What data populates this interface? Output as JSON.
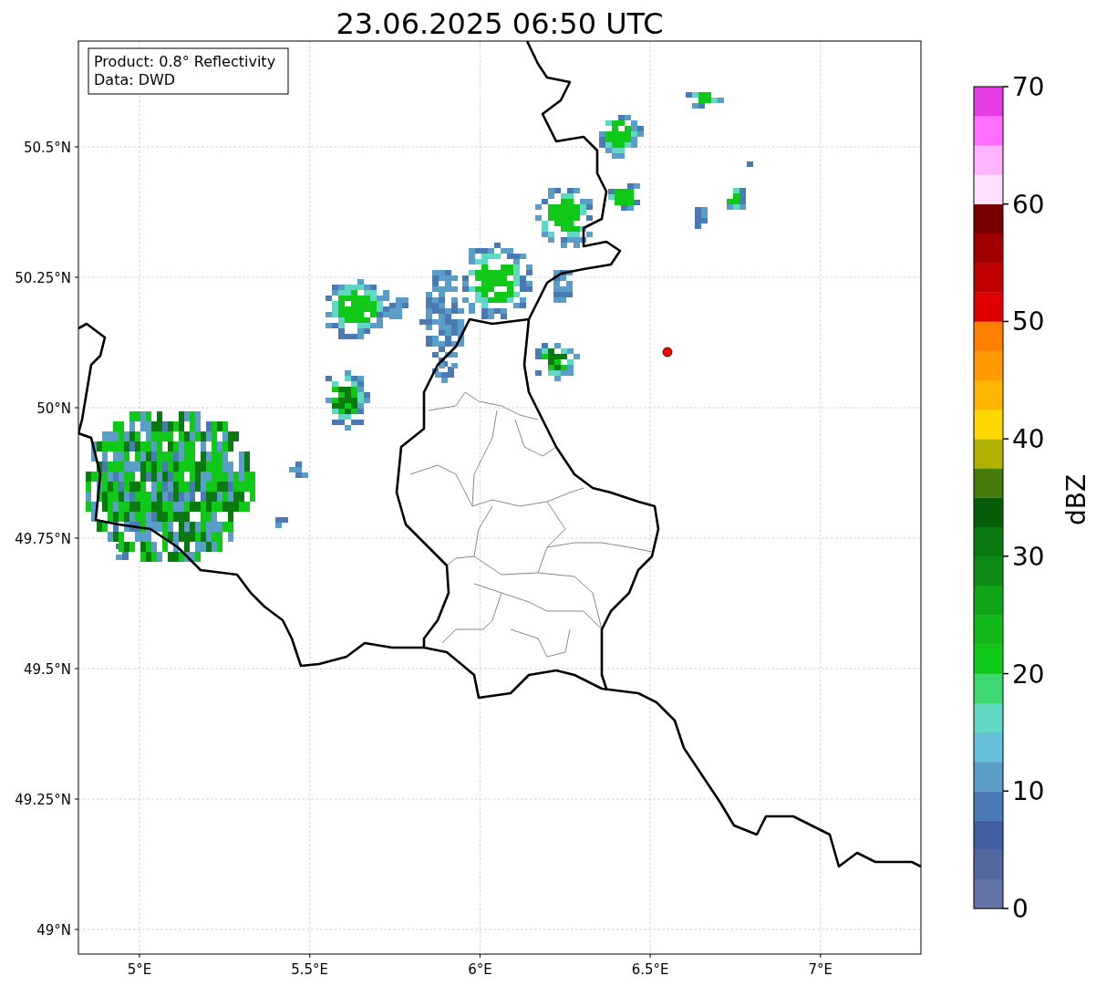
{
  "title": "23.06.2025 06:50 UTC",
  "info_box": [
    "Product: 0.8° Reflectivity",
    "Data: DWD"
  ],
  "axes": {
    "xticks": [
      "5°E",
      "5.5°E",
      "6°E",
      "6.5°E",
      "7°E"
    ],
    "yticks": [
      "50.5°N",
      "50.25°N",
      "50°N",
      "49.75°N",
      "49.5°N",
      "49.25°N",
      "49°N"
    ]
  },
  "colorbar": {
    "label": "dBZ",
    "ticks": [
      "70",
      "60",
      "50",
      "40",
      "30",
      "20",
      "10",
      "0"
    ],
    "bins": [
      {
        "color": "#6474a6"
      },
      {
        "color": "#52689e"
      },
      {
        "color": "#4260a0"
      },
      {
        "color": "#4a7ab4"
      },
      {
        "color": "#5a9ec8"
      },
      {
        "color": "#66c0dc"
      },
      {
        "color": "#60d8c4"
      },
      {
        "color": "#3ed870"
      },
      {
        "color": "#10c818"
      },
      {
        "color": "#10b818"
      },
      {
        "color": "#10a418"
      },
      {
        "color": "#0c8c14"
      },
      {
        "color": "#0a7a10"
      },
      {
        "color": "#065e0a"
      },
      {
        "color": "#467a0a"
      },
      {
        "color": "#b0b000"
      },
      {
        "color": "#ffd700"
      },
      {
        "color": "#ffb400"
      },
      {
        "color": "#ff9b00"
      },
      {
        "color": "#ff7f00"
      },
      {
        "color": "#e00000"
      },
      {
        "color": "#c00000"
      },
      {
        "color": "#a00000"
      },
      {
        "color": "#780000"
      },
      {
        "color": "#ffe0ff"
      },
      {
        "color": "#ffb4ff"
      },
      {
        "color": "#ff6eff"
      },
      {
        "color": "#e63ce6"
      }
    ]
  }
}
